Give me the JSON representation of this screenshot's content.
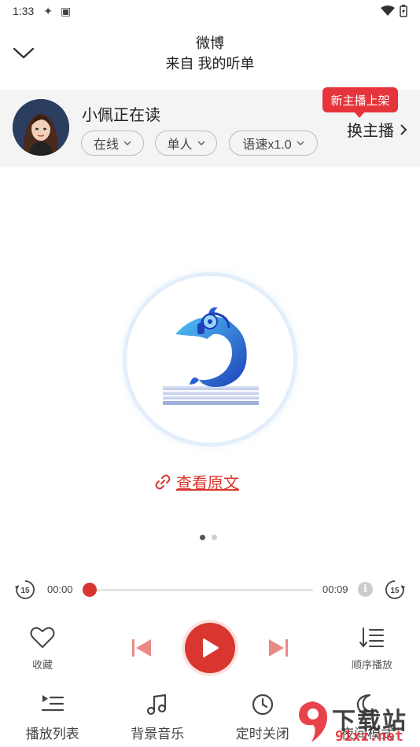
{
  "status_bar": {
    "time": "1:33"
  },
  "header": {
    "title": "微博",
    "subtitle": "来自 我的听单"
  },
  "anchor": {
    "name": "小佩正在读",
    "online_label": "在线",
    "single_label": "单人",
    "speed_label": "语速x1.0",
    "switch_label": "换主播",
    "new_badge": "新主播上架"
  },
  "cover": {
    "link_label": "查看原文"
  },
  "pager": {
    "total": 2,
    "active": 0
  },
  "player": {
    "current_time": "00:00",
    "total_time": "00:09",
    "progress": 0,
    "skip_back": "15",
    "skip_forward": "15",
    "favorite_label": "收藏",
    "order_label": "顺序播放"
  },
  "bottom_nav": [
    {
      "label": "播放列表",
      "icon": "playlist-icon"
    },
    {
      "label": "背景音乐",
      "icon": "music-note-icon"
    },
    {
      "label": "定时关闭",
      "icon": "clock-icon"
    },
    {
      "label": "夜间模式",
      "icon": "moon-icon"
    }
  ],
  "watermark": {
    "line1": "下载站",
    "line2": "91xz.net"
  },
  "colors": {
    "accent": "#d9362f",
    "badge": "#e5343b",
    "bar_bg": "#f4f4f4"
  }
}
